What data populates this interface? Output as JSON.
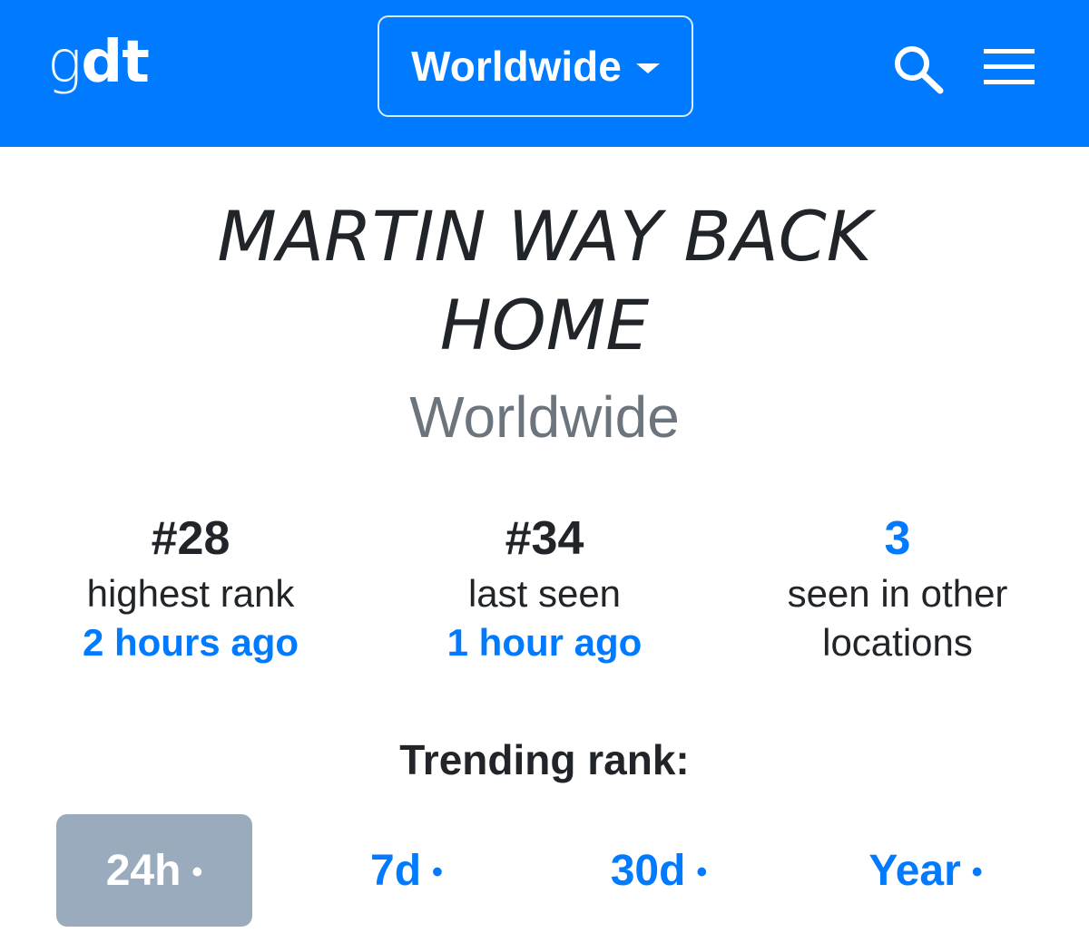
{
  "header": {
    "logo_light": "g",
    "logo_bold": "dt",
    "location_label": "Worldwide",
    "search_icon": "search-icon",
    "menu_icon": "hamburger-menu-icon",
    "brand_color": "#007bff"
  },
  "hero": {
    "title_line1": "MARTIN WAY BACK",
    "title_line2": "HOME",
    "location": "Worldwide"
  },
  "stats": [
    {
      "value": "#28",
      "label": "highest rank",
      "time": "2 hours ago"
    },
    {
      "value": "#34",
      "label": "last seen",
      "time": "1 hour ago"
    },
    {
      "value": "3",
      "label_line1": "seen in other",
      "label_line2": "locations"
    }
  ],
  "trending": {
    "label": "Trending rank:",
    "tabs": [
      {
        "label": "24h",
        "dot": "•",
        "active": true
      },
      {
        "label": "7d",
        "dot": "•",
        "active": false
      },
      {
        "label": "30d",
        "dot": "•",
        "active": false
      },
      {
        "label": "Year",
        "dot": "•",
        "active": false
      }
    ]
  }
}
